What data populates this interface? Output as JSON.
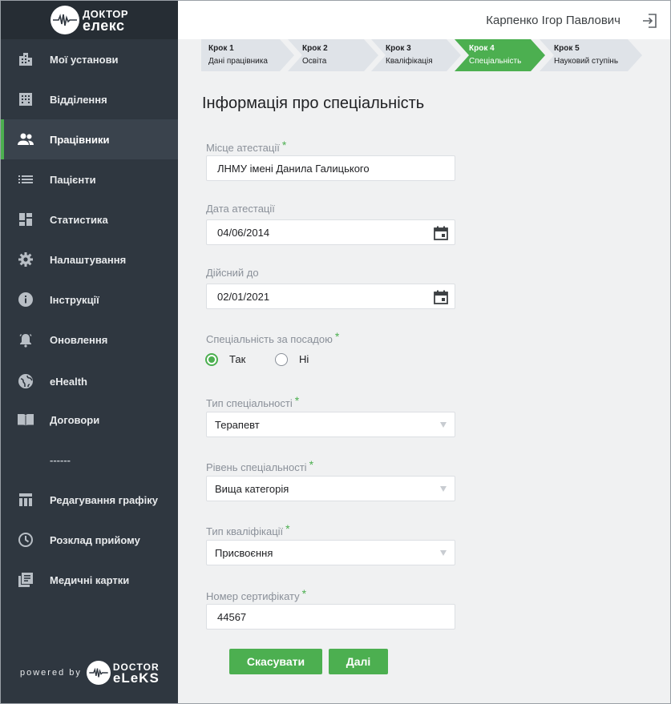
{
  "app": {
    "logo_line1": "ДОКТОР",
    "logo_line2": "елекс",
    "user_name": "Карпенко Ігор Павлович",
    "accent_color": "#4caf50"
  },
  "sidebar": {
    "items": [
      {
        "label": "Мої установи",
        "icon": "building-icon"
      },
      {
        "label": "Відділення",
        "icon": "department-icon"
      },
      {
        "label": "Працівники",
        "icon": "people-icon",
        "active": true
      },
      {
        "label": "Пацієнти",
        "icon": "list-icon"
      },
      {
        "label": "Статистика",
        "icon": "dashboard-icon"
      },
      {
        "label": "Налаштування",
        "icon": "gear-icon"
      },
      {
        "label": "Інструкції",
        "icon": "info-icon"
      },
      {
        "label": "Оновлення",
        "icon": "bell-icon"
      },
      {
        "label": "eHealth",
        "icon": "globe-icon"
      },
      {
        "label": "Договори",
        "icon": "book-icon"
      },
      {
        "label": "Редагування графіку",
        "icon": "table-icon"
      },
      {
        "label": "Розклад прийому",
        "icon": "clock-icon"
      },
      {
        "label": "Медичні картки",
        "icon": "cards-icon"
      }
    ],
    "separator": "------",
    "powered_by": "powered by",
    "brand_line1": "DOCTOR",
    "brand_line2": "eLeKS"
  },
  "stepper": {
    "steps": [
      {
        "num": "Крок 1",
        "name": "Дані працівника"
      },
      {
        "num": "Крок 2",
        "name": "Освіта"
      },
      {
        "num": "Крок 3",
        "name": "Кваліфікація"
      },
      {
        "num": "Крок 4",
        "name": "Спеціальність",
        "active": true
      },
      {
        "num": "Крок 5",
        "name": "Науковий ступінь"
      }
    ]
  },
  "form": {
    "title": "Інформація про спеціальність",
    "attestation_place_label": "Місце атестації",
    "attestation_place_value": "ЛНМУ імені Данила Галицького",
    "attestation_date_label": "Дата атестації",
    "attestation_date_value": "04/06/2014",
    "valid_until_label": "Дійсний до",
    "valid_until_value": "02/01/2021",
    "specialty_by_position_label": "Спеціальність за посадою",
    "option_yes": "Так",
    "option_no": "Ні",
    "selected_option": "Так",
    "specialty_type_label": "Тип спеціальності",
    "specialty_type_value": "Терапевт",
    "specialty_level_label": "Рівень спеціальності",
    "specialty_level_value": "Вища категорія",
    "qualification_type_label": "Тип кваліфікації",
    "qualification_type_value": "Присвоєння",
    "certificate_number_label": "Номер сертифікату",
    "certificate_number_value": "44567",
    "required_mark": "*",
    "cancel_label": "Скасувати",
    "next_label": "Далі"
  }
}
